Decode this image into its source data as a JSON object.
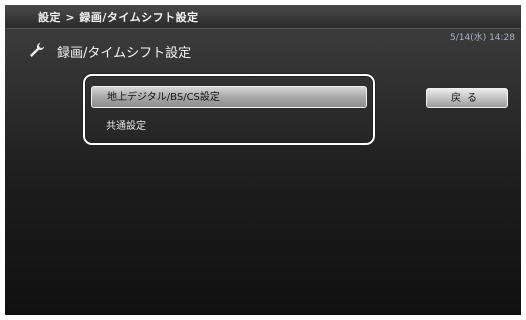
{
  "header": {
    "breadcrumb": "設定 > 録画/タイムシフト設定",
    "datetime": "5/14(水) 14:28"
  },
  "page": {
    "title": "録画/タイムシフト設定",
    "icon": "wrench-icon"
  },
  "menu": {
    "items": [
      {
        "label": "地上デジタル/BS/CS設定",
        "selected": true
      },
      {
        "label": "共通設定",
        "selected": false
      }
    ]
  },
  "buttons": {
    "back_label": "戻る"
  },
  "colors": {
    "background": "#1a1a1a",
    "selected_item": "#b0b0b0",
    "text": "#f0f0f0",
    "datetime": "#aab0c8"
  }
}
